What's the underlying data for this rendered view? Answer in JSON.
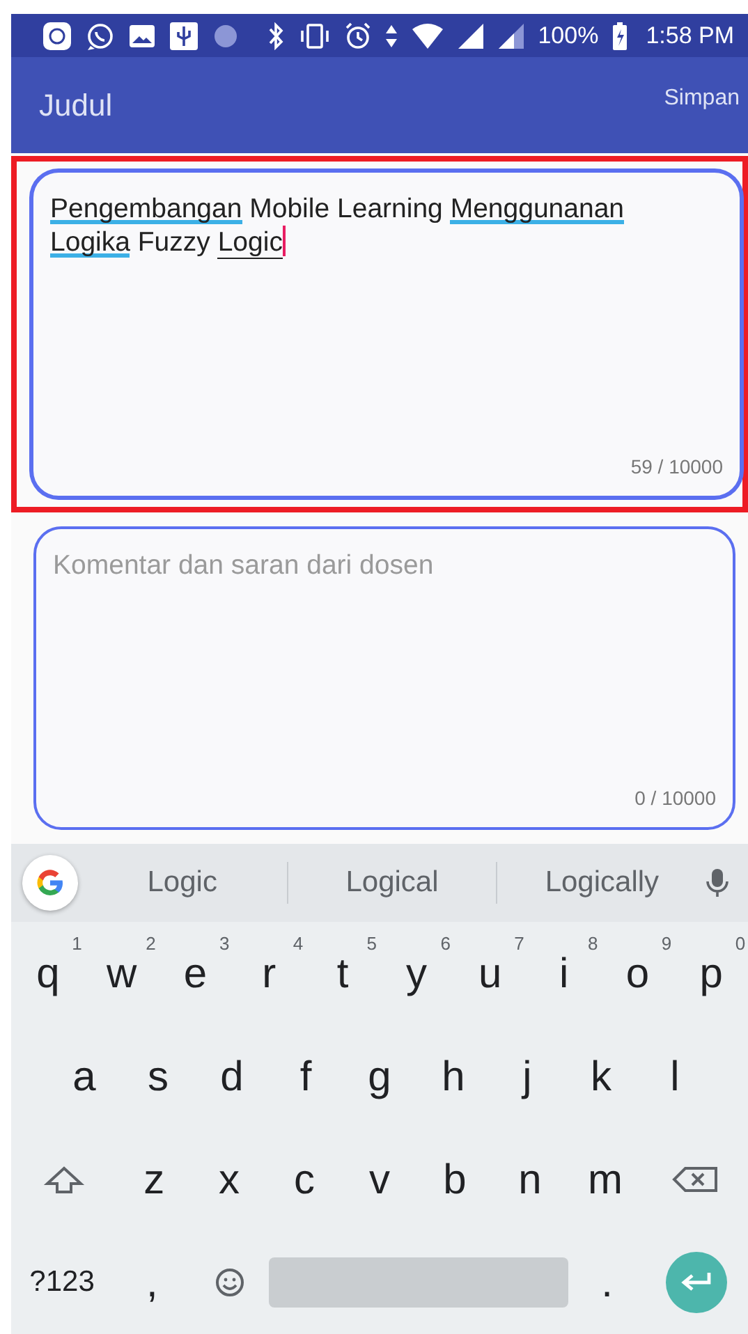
{
  "status_bar": {
    "battery": "100%",
    "time": "1:58 PM"
  },
  "app_bar": {
    "title": "Judul",
    "action": "Simpan"
  },
  "fields": [
    {
      "highlighted": true,
      "focused": true,
      "words": [
        {
          "text": "Pengembangan",
          "misspelled": true,
          "composing": false
        },
        {
          "text": "Mobile",
          "misspelled": false,
          "composing": false
        },
        {
          "text": "Learning",
          "misspelled": false,
          "composing": false
        },
        {
          "text": "Menggunanan",
          "misspelled": true,
          "composing": false
        },
        {
          "text": "Logika",
          "misspelled": true,
          "composing": false
        },
        {
          "text": "Fuzzy",
          "misspelled": false,
          "composing": false
        },
        {
          "text": "Logic",
          "misspelled": false,
          "composing": true
        }
      ],
      "counter": "59 / 10000"
    },
    {
      "highlighted": false,
      "focused": false,
      "placeholder": "Komentar dan saran dari dosen",
      "counter": "0 / 10000"
    }
  ],
  "keyboard": {
    "suggestions": [
      "Logic",
      "Logical",
      "Logically"
    ],
    "rows": [
      {
        "keys": [
          {
            "kind": "letter",
            "label": "q",
            "hint": "1"
          },
          {
            "kind": "letter",
            "label": "w",
            "hint": "2"
          },
          {
            "kind": "letter",
            "label": "e",
            "hint": "3"
          },
          {
            "kind": "letter",
            "label": "r",
            "hint": "4"
          },
          {
            "kind": "letter",
            "label": "t",
            "hint": "5"
          },
          {
            "kind": "letter",
            "label": "y",
            "hint": "6"
          },
          {
            "kind": "letter",
            "label": "u",
            "hint": "7"
          },
          {
            "kind": "letter",
            "label": "i",
            "hint": "8"
          },
          {
            "kind": "letter",
            "label": "o",
            "hint": "9"
          },
          {
            "kind": "letter",
            "label": "p",
            "hint": "0"
          }
        ]
      },
      {
        "keys": [
          {
            "kind": "letter",
            "label": "a"
          },
          {
            "kind": "letter",
            "label": "s"
          },
          {
            "kind": "letter",
            "label": "d"
          },
          {
            "kind": "letter",
            "label": "f"
          },
          {
            "kind": "letter",
            "label": "g"
          },
          {
            "kind": "letter",
            "label": "h"
          },
          {
            "kind": "letter",
            "label": "j"
          },
          {
            "kind": "letter",
            "label": "k"
          },
          {
            "kind": "letter",
            "label": "l"
          }
        ]
      },
      {
        "keys": [
          {
            "kind": "shift"
          },
          {
            "kind": "letter",
            "label": "z"
          },
          {
            "kind": "letter",
            "label": "x"
          },
          {
            "kind": "letter",
            "label": "c"
          },
          {
            "kind": "letter",
            "label": "v"
          },
          {
            "kind": "letter",
            "label": "b"
          },
          {
            "kind": "letter",
            "label": "n"
          },
          {
            "kind": "letter",
            "label": "m"
          },
          {
            "kind": "backspace"
          }
        ]
      },
      {
        "keys": [
          {
            "kind": "symbols",
            "label": "?123"
          },
          {
            "kind": "letter",
            "label": ","
          },
          {
            "kind": "emoji"
          },
          {
            "kind": "space"
          },
          {
            "kind": "letter",
            "label": "."
          },
          {
            "kind": "enter"
          }
        ]
      }
    ]
  }
}
